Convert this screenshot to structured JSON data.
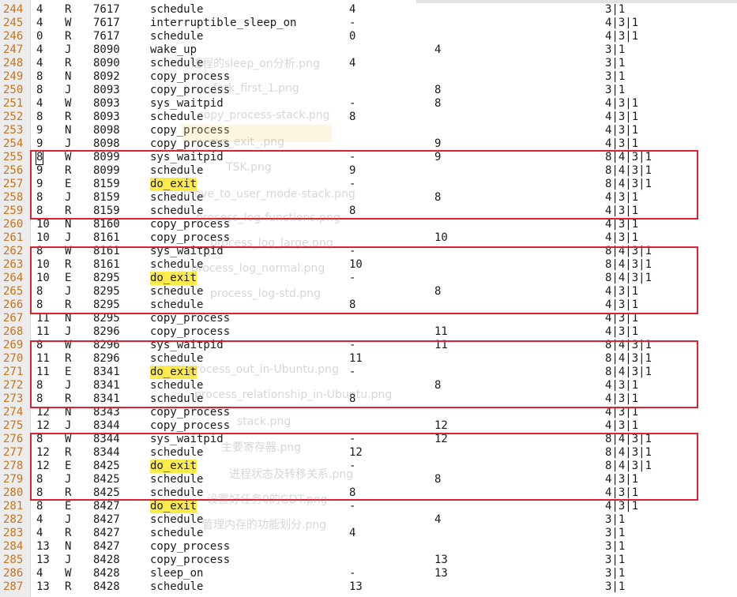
{
  "log": {
    "rows": [
      {
        "n": "244",
        "pid": "4",
        "state": "R",
        "time": "7617",
        "fn": "schedule",
        "a": "4",
        "b": "",
        "stack": "3|1"
      },
      {
        "n": "245",
        "pid": "4",
        "state": "W",
        "time": "7617",
        "fn": "interruptible_sleep_on",
        "a": "-",
        "b": "",
        "stack": "4|3|1"
      },
      {
        "n": "246",
        "pid": "0",
        "state": "R",
        "time": "7617",
        "fn": "schedule",
        "a": "0",
        "b": "",
        "stack": "4|3|1"
      },
      {
        "n": "247",
        "pid": "4",
        "state": "J",
        "time": "8090",
        "fn": "wake_up",
        "a": "",
        "b": "4",
        "stack": "3|1"
      },
      {
        "n": "248",
        "pid": "4",
        "state": "R",
        "time": "8090",
        "fn": "schedule",
        "a": "4",
        "b": "",
        "stack": "3|1"
      },
      {
        "n": "249",
        "pid": "8",
        "state": "N",
        "time": "8092",
        "fn": "copy_process",
        "a": "",
        "b": "",
        "stack": "3|1"
      },
      {
        "n": "250",
        "pid": "8",
        "state": "J",
        "time": "8093",
        "fn": "copy_process",
        "a": "",
        "b": "8",
        "stack": "3|1"
      },
      {
        "n": "251",
        "pid": "4",
        "state": "W",
        "time": "8093",
        "fn": "sys_waitpid",
        "a": "-",
        "b": "8",
        "stack": "4|3|1"
      },
      {
        "n": "252",
        "pid": "8",
        "state": "R",
        "time": "8093",
        "fn": "schedule",
        "a": "8",
        "b": "",
        "stack": "4|3|1"
      },
      {
        "n": "253",
        "pid": "9",
        "state": "N",
        "time": "8098",
        "fn": "copy_process",
        "a": "",
        "b": "",
        "stack": "4|3|1"
      },
      {
        "n": "254",
        "pid": "9",
        "state": "J",
        "time": "8098",
        "fn": "copy_process",
        "a": "",
        "b": "9",
        "stack": "4|3|1"
      },
      {
        "n": "255",
        "pid": "8",
        "state": "W",
        "time": "8099",
        "fn": "sys_waitpid",
        "a": "-",
        "b": "9",
        "stack": "8|4|3|1",
        "cursor": true
      },
      {
        "n": "256",
        "pid": "9",
        "state": "R",
        "time": "8099",
        "fn": "schedule",
        "a": "9",
        "b": "",
        "stack": "8|4|3|1"
      },
      {
        "n": "257",
        "pid": "9",
        "state": "E",
        "time": "8159",
        "fn": "do_exit",
        "a": "-",
        "b": "",
        "stack": "8|4|3|1",
        "hl": true
      },
      {
        "n": "258",
        "pid": "8",
        "state": "J",
        "time": "8159",
        "fn": "schedule",
        "a": "",
        "b": "8",
        "stack": "4|3|1"
      },
      {
        "n": "259",
        "pid": "8",
        "state": "R",
        "time": "8159",
        "fn": "schedule",
        "a": "8",
        "b": "",
        "stack": "4|3|1"
      },
      {
        "n": "260",
        "pid": "10",
        "state": "N",
        "time": "8160",
        "fn": "copy_process",
        "a": "",
        "b": "",
        "stack": "4|3|1"
      },
      {
        "n": "261",
        "pid": "10",
        "state": "J",
        "time": "8161",
        "fn": "copy_process",
        "a": "",
        "b": "10",
        "stack": "4|3|1"
      },
      {
        "n": "262",
        "pid": "8",
        "state": "W",
        "time": "8161",
        "fn": "sys_waitpid",
        "a": "-",
        "b": "",
        "stack": "8|4|3|1"
      },
      {
        "n": "263",
        "pid": "10",
        "state": "R",
        "time": "8161",
        "fn": "schedule",
        "a": "10",
        "b": "",
        "stack": "8|4|3|1"
      },
      {
        "n": "264",
        "pid": "10",
        "state": "E",
        "time": "8295",
        "fn": "do_exit",
        "a": "-",
        "b": "",
        "stack": "8|4|3|1",
        "hl": true
      },
      {
        "n": "265",
        "pid": "8",
        "state": "J",
        "time": "8295",
        "fn": "schedule",
        "a": "",
        "b": "8",
        "stack": "4|3|1"
      },
      {
        "n": "266",
        "pid": "8",
        "state": "R",
        "time": "8295",
        "fn": "schedule",
        "a": "8",
        "b": "",
        "stack": "4|3|1"
      },
      {
        "n": "267",
        "pid": "11",
        "state": "N",
        "time": "8295",
        "fn": "copy_process",
        "a": "",
        "b": "",
        "stack": "4|3|1"
      },
      {
        "n": "268",
        "pid": "11",
        "state": "J",
        "time": "8296",
        "fn": "copy_process",
        "a": "",
        "b": "11",
        "stack": "4|3|1"
      },
      {
        "n": "269",
        "pid": "8",
        "state": "W",
        "time": "8296",
        "fn": "sys_waitpid",
        "a": "-",
        "b": "11",
        "stack": "8|4|3|1"
      },
      {
        "n": "270",
        "pid": "11",
        "state": "R",
        "time": "8296",
        "fn": "schedule",
        "a": "11",
        "b": "",
        "stack": "8|4|3|1"
      },
      {
        "n": "271",
        "pid": "11",
        "state": "E",
        "time": "8341",
        "fn": "do_exit",
        "a": "-",
        "b": "",
        "stack": "8|4|3|1",
        "hl": true
      },
      {
        "n": "272",
        "pid": "8",
        "state": "J",
        "time": "8341",
        "fn": "schedule",
        "a": "",
        "b": "8",
        "stack": "4|3|1"
      },
      {
        "n": "273",
        "pid": "8",
        "state": "R",
        "time": "8341",
        "fn": "schedule",
        "a": "8",
        "b": "",
        "stack": "4|3|1"
      },
      {
        "n": "274",
        "pid": "12",
        "state": "N",
        "time": "8343",
        "fn": "copy_process",
        "a": "",
        "b": "",
        "stack": "4|3|1"
      },
      {
        "n": "275",
        "pid": "12",
        "state": "J",
        "time": "8344",
        "fn": "copy_process",
        "a": "",
        "b": "12",
        "stack": "4|3|1"
      },
      {
        "n": "276",
        "pid": "8",
        "state": "W",
        "time": "8344",
        "fn": "sys_waitpid",
        "a": "-",
        "b": "12",
        "stack": "8|4|3|1"
      },
      {
        "n": "277",
        "pid": "12",
        "state": "R",
        "time": "8344",
        "fn": "schedule",
        "a": "12",
        "b": "",
        "stack": "8|4|3|1"
      },
      {
        "n": "278",
        "pid": "12",
        "state": "E",
        "time": "8425",
        "fn": "do_exit",
        "a": "-",
        "b": "",
        "stack": "8|4|3|1",
        "hl": true
      },
      {
        "n": "279",
        "pid": "8",
        "state": "J",
        "time": "8425",
        "fn": "schedule",
        "a": "",
        "b": "8",
        "stack": "4|3|1"
      },
      {
        "n": "280",
        "pid": "8",
        "state": "R",
        "time": "8425",
        "fn": "schedule",
        "a": "8",
        "b": "",
        "stack": "4|3|1"
      },
      {
        "n": "281",
        "pid": "8",
        "state": "E",
        "time": "8427",
        "fn": "do_exit",
        "a": "-",
        "b": "",
        "stack": "4|3|1",
        "hl": true
      },
      {
        "n": "282",
        "pid": "4",
        "state": "J",
        "time": "8427",
        "fn": "schedule",
        "a": "",
        "b": "4",
        "stack": "3|1"
      },
      {
        "n": "283",
        "pid": "4",
        "state": "R",
        "time": "8427",
        "fn": "schedule",
        "a": "4",
        "b": "",
        "stack": "3|1"
      },
      {
        "n": "284",
        "pid": "13",
        "state": "N",
        "time": "8427",
        "fn": "copy_process",
        "a": "",
        "b": "",
        "stack": "3|1"
      },
      {
        "n": "285",
        "pid": "13",
        "state": "J",
        "time": "8428",
        "fn": "copy_process",
        "a": "",
        "b": "13",
        "stack": "3|1"
      },
      {
        "n": "286",
        "pid": "4",
        "state": "W",
        "time": "8428",
        "fn": "sleep_on",
        "a": "-",
        "b": "13",
        "stack": "3|1"
      },
      {
        "n": "287",
        "pid": "13",
        "state": "R",
        "time": "8428",
        "fn": "schedule",
        "a": "13",
        "b": "",
        "stack": "3|1"
      }
    ]
  },
  "ghost_overlay": [
    "进程的sleep_on分析.png",
    "fork_first_1.png",
    "copy_process-stack.png",
    "sys_exit_.png",
    "TSK.png",
    "move_to_user_mode-stack.png",
    "process_log-functions.png",
    "process_log_large.png",
    "process_log_normal.png",
    "process_log-std.png",
    "process_out_in-Ubuntu.png",
    "process_relationship_in-Ubuntu.png",
    "stack.png",
    "主要寄存器.png",
    "进程状态及转移关系.png",
    "设置好任务0的GDT.png",
    "管理内存的功能划分.png"
  ]
}
